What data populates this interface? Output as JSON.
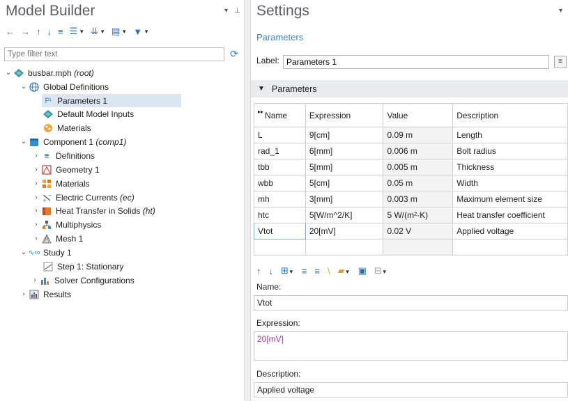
{
  "model_builder": {
    "title": "Model Builder",
    "filter_placeholder": "Type filter text",
    "tree": [
      {
        "label": "busbar.mph",
        "suffix": "(root)"
      },
      {
        "label": "Global Definitions"
      },
      {
        "label": "Parameters 1"
      },
      {
        "label": "Default Model Inputs"
      },
      {
        "label": "Materials"
      },
      {
        "label": "Component 1",
        "suffix": "(comp1)"
      },
      {
        "label": "Definitions"
      },
      {
        "label": "Geometry 1"
      },
      {
        "label": "Materials"
      },
      {
        "label": "Electric Currents",
        "suffix": "(ec)"
      },
      {
        "label": "Heat Transfer in Solids",
        "suffix": "(ht)"
      },
      {
        "label": "Multiphysics"
      },
      {
        "label": "Mesh 1"
      },
      {
        "label": "Study 1"
      },
      {
        "label": "Step 1: Stationary"
      },
      {
        "label": "Solver Configurations"
      },
      {
        "label": "Results"
      }
    ]
  },
  "settings": {
    "title": "Settings",
    "subtitle": "Parameters",
    "label_caption": "Label:",
    "label_value": "Parameters 1",
    "section_title": "Parameters",
    "table": {
      "headers": [
        "Name",
        "Expression",
        "Value",
        "Description"
      ],
      "rows": [
        [
          "L",
          "9[cm]",
          "0.09 m",
          "Length"
        ],
        [
          "rad_1",
          "6[mm]",
          "0.006 m",
          "Bolt radius"
        ],
        [
          "tbb",
          "5[mm]",
          "0.005 m",
          "Thickness"
        ],
        [
          "wbb",
          "5[cm]",
          "0.05 m",
          "Width"
        ],
        [
          "mh",
          "3[mm]",
          "0.003 m",
          "Maximum element size"
        ],
        [
          "htc",
          "5[W/m^2/K]",
          "5 W/(m²·K)",
          "Heat transfer coefficient"
        ],
        [
          "Vtot",
          "20[mV]",
          "0.02 V",
          "Applied voltage"
        ]
      ]
    },
    "name_caption": "Name:",
    "name_value": "Vtot",
    "expression_caption": "Expression:",
    "expression_value": "20[mV]",
    "description_caption": "Description:",
    "description_value": "Applied voltage"
  },
  "colors": {
    "selection": "#dce6f1",
    "accent_blue": "#2b6fb3",
    "section_bg": "#e9ecef",
    "expression_text": "#a23aa6"
  }
}
